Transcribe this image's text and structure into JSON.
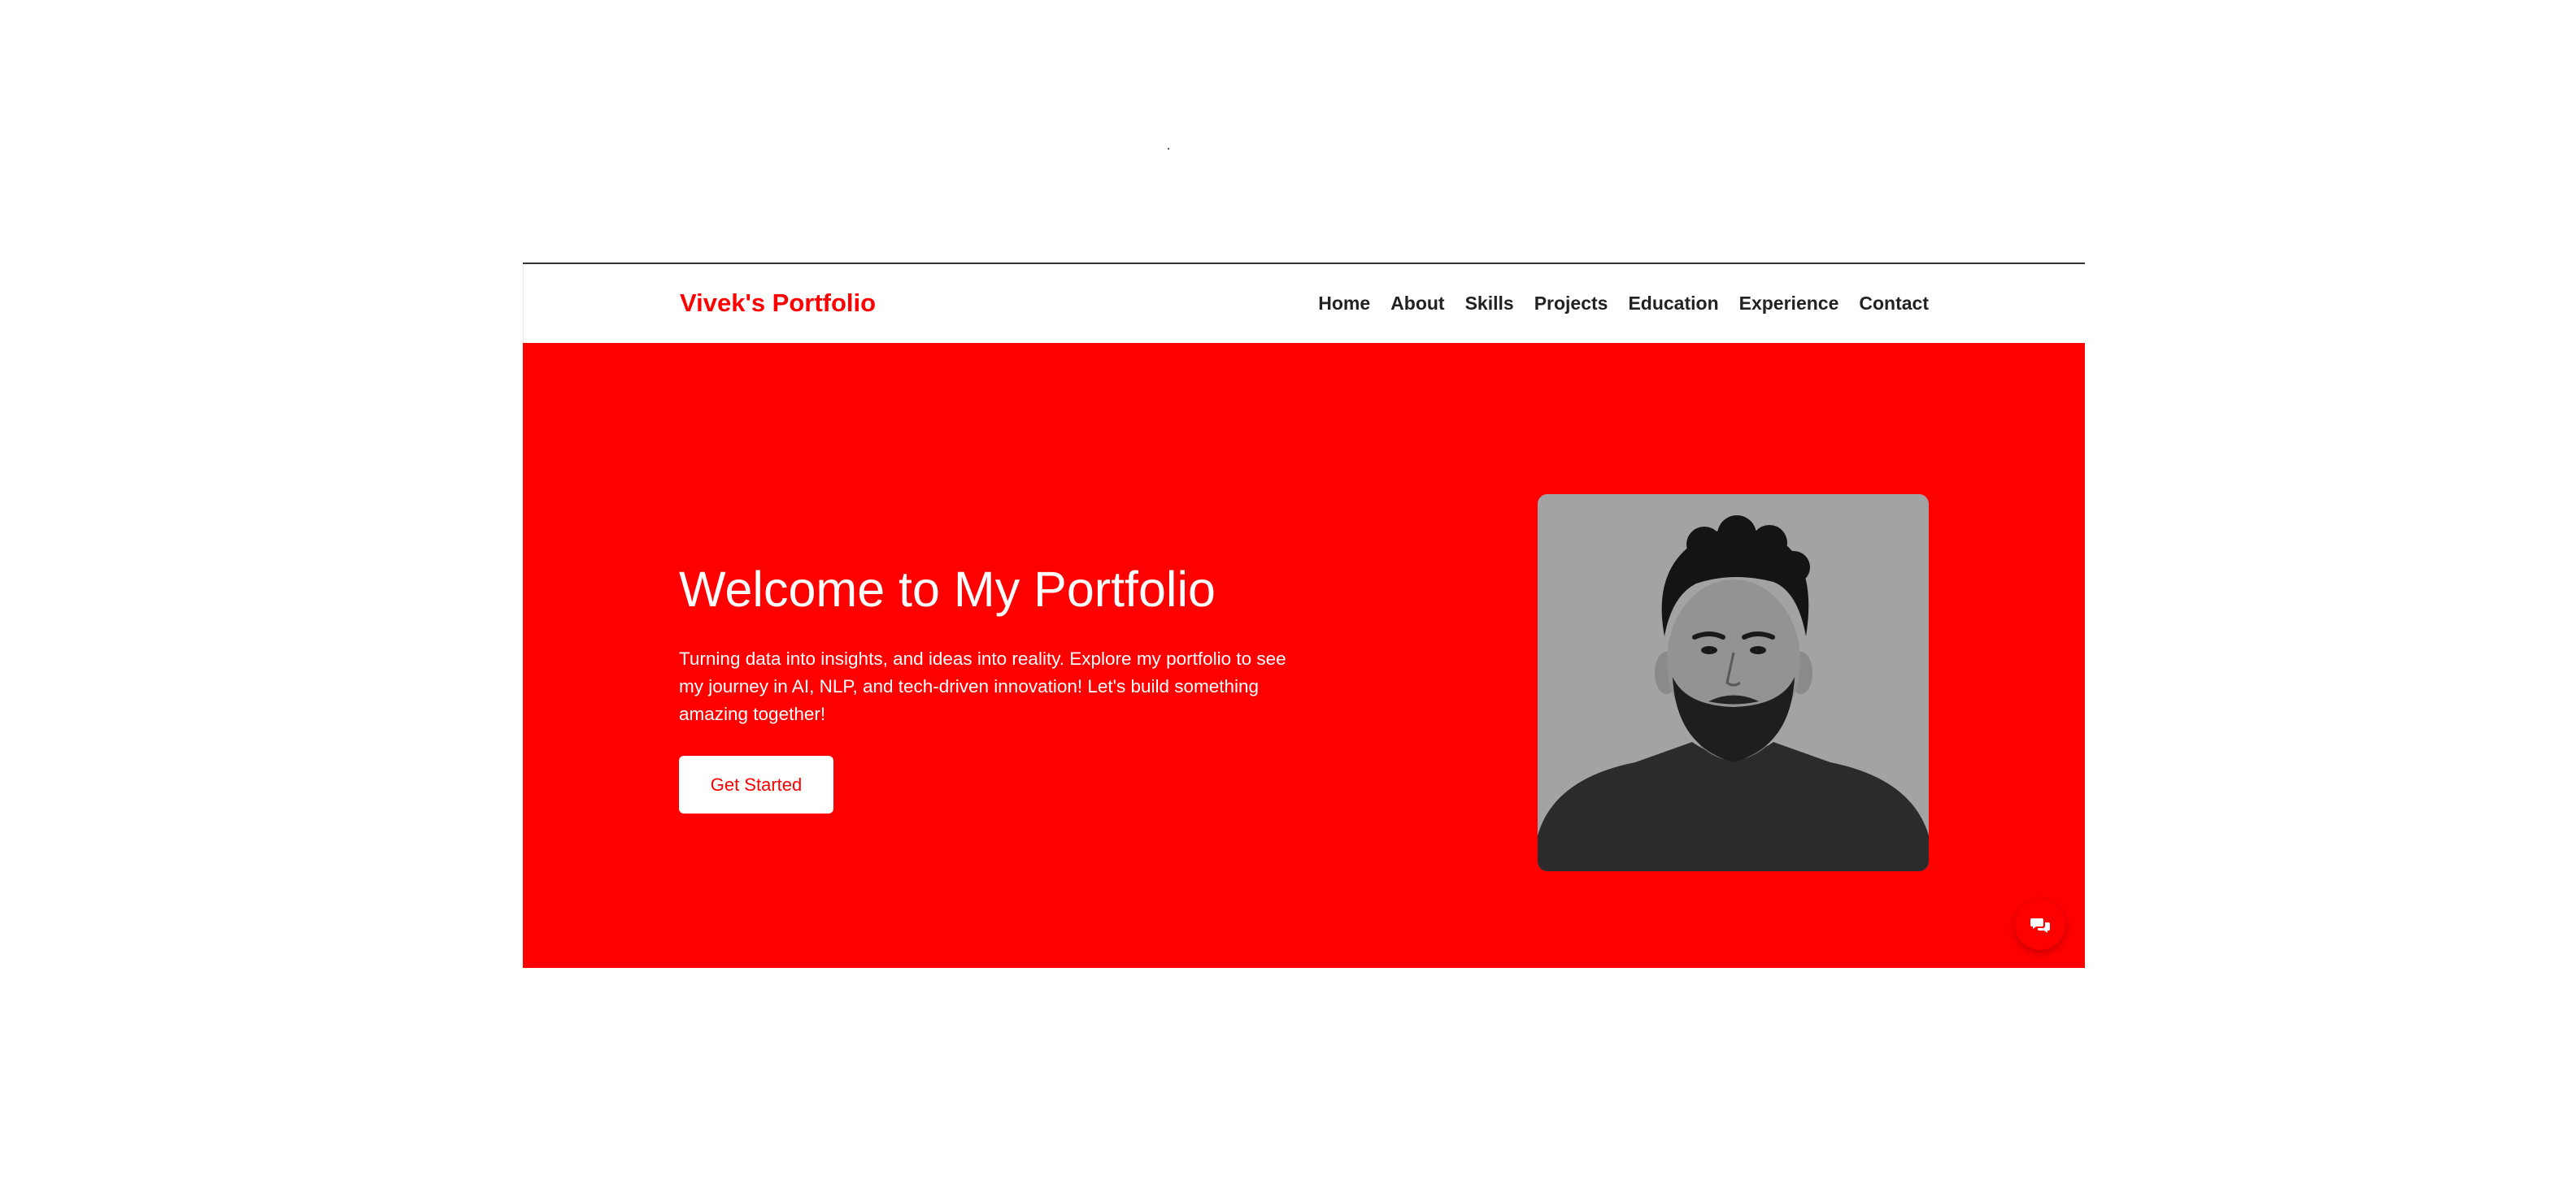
{
  "navbar": {
    "brand": "Vivek's Portfolio",
    "items": [
      {
        "label": "Home"
      },
      {
        "label": "About"
      },
      {
        "label": "Skills"
      },
      {
        "label": "Projects"
      },
      {
        "label": "Education"
      },
      {
        "label": "Experience"
      },
      {
        "label": "Contact"
      }
    ]
  },
  "hero": {
    "title": "Welcome to My Portfolio",
    "description": "Turning data into insights, and ideas into reality. Explore my portfolio to see my journey in AI, NLP, and tech-driven innovation! Let's build something amazing together!",
    "cta_label": "Get Started",
    "photo": "profile-photo",
    "chat_icon": "chat-icon"
  },
  "colors": {
    "accent": "#ff0000",
    "nav_text": "#222222",
    "hero_text": "#ffffff",
    "photo_bg": "#a3a3a3"
  }
}
